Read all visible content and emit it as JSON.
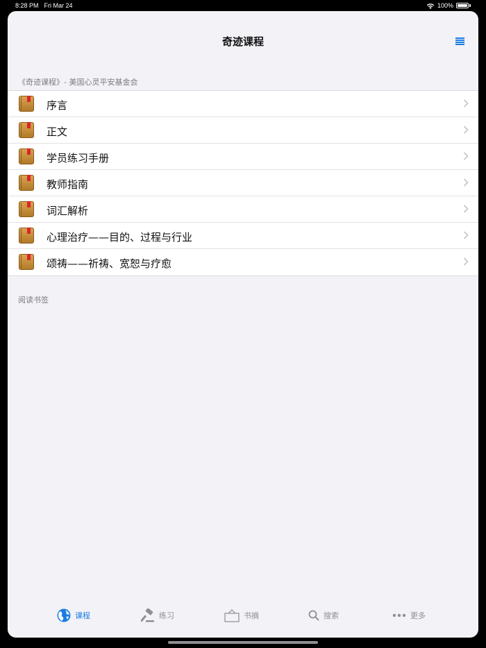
{
  "status_bar": {
    "time": "8:28 PM",
    "date": "Fri Mar 24",
    "battery": "100%"
  },
  "nav": {
    "title": "奇迹课程",
    "right_icon": "list-icon",
    "accent": "#1a7ce2"
  },
  "section1": {
    "header": "《奇迹课程》- 美国心灵平安基金会",
    "items": [
      {
        "label": "序言"
      },
      {
        "label": "正文"
      },
      {
        "label": "学员练习手册"
      },
      {
        "label": "教师指南"
      },
      {
        "label": "词汇解析"
      },
      {
        "label": "心理治疗——目的、过程与行业"
      },
      {
        "label": "颂祷——祈祷、宽恕与疗愈"
      }
    ]
  },
  "section2": {
    "header": "阅读书签"
  },
  "tabbar": {
    "tabs": [
      {
        "label": "课程",
        "icon": "globe-icon",
        "active": true
      },
      {
        "label": "练习",
        "icon": "gavel-icon",
        "active": false
      },
      {
        "label": "书摘",
        "icon": "basket-icon",
        "active": false
      },
      {
        "label": "搜索",
        "icon": "search-icon",
        "active": false
      },
      {
        "label": "更多",
        "icon": "more-icon",
        "active": false
      }
    ]
  }
}
